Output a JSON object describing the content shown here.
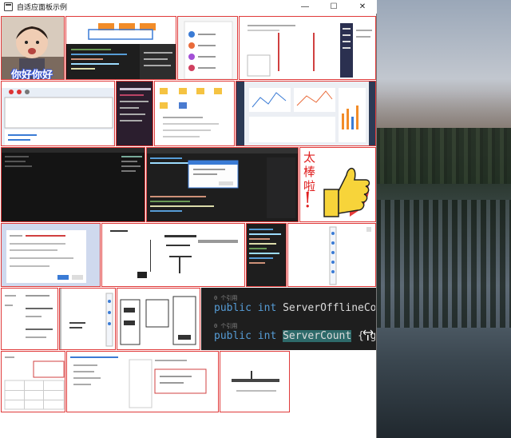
{
  "window": {
    "title": "自适应面板示例",
    "controls": {
      "minimize": "—",
      "maximize": "☐",
      "close": "✕"
    }
  },
  "tiles": {
    "baby": {
      "caption": "你好你好"
    },
    "thumbs": {
      "chars": [
        "太",
        "棒",
        "啦",
        "!"
      ]
    },
    "code": {
      "ref_1": "0 个引用",
      "line_1": {
        "modifier": "public",
        "type": "int",
        "name": "ServerOfflineCount",
        "tail": "{"
      },
      "ref_2": "0 个引用",
      "line_2": {
        "modifier": "public",
        "type": "int",
        "name": "ServerCount",
        "tail": "{ get"
      }
    }
  },
  "colors": {
    "tile_border": "#e03a3a",
    "code_bg": "#1e1e1e",
    "keyword": "#569cd6",
    "highlight": "#2e6a6a"
  }
}
